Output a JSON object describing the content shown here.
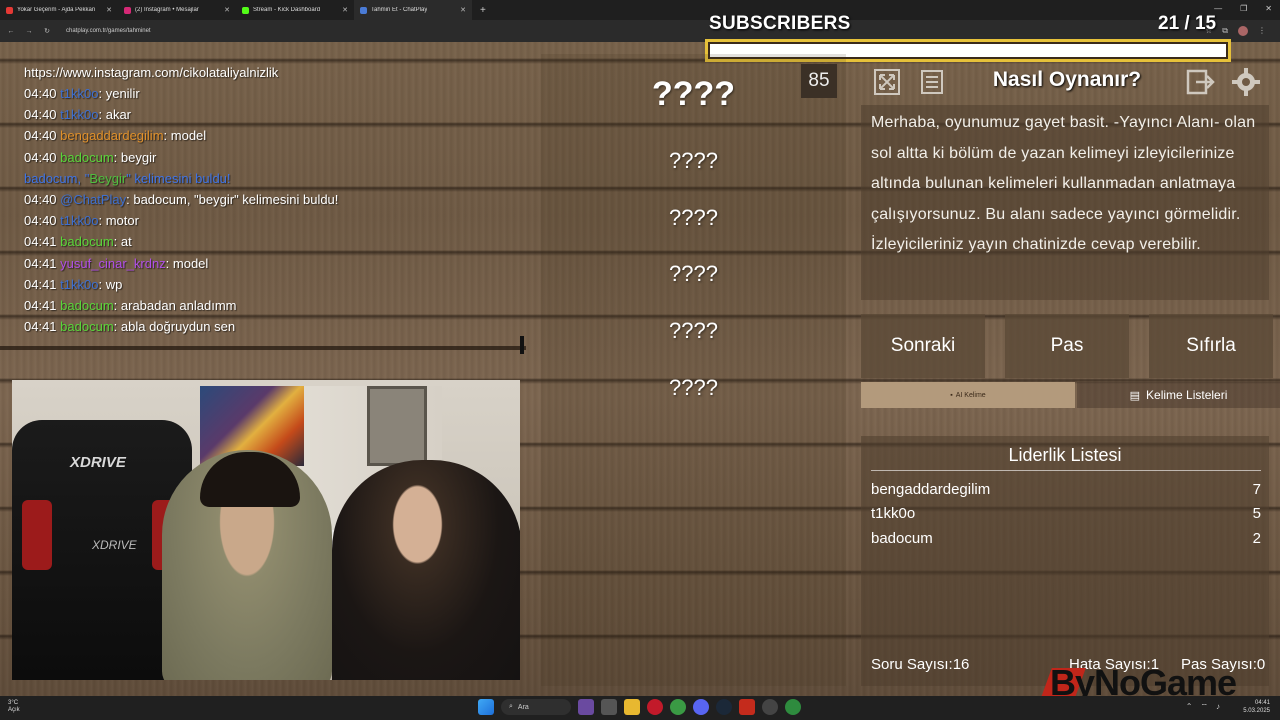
{
  "browser": {
    "tabs": [
      {
        "label": "Yokar Geçerim - Ajda Pekkan",
        "color": "#e53935"
      },
      {
        "label": "(2) Instagram • Mesajlar",
        "color": "#d62976"
      },
      {
        "label": "Stream - Kick Dashboard",
        "color": "#53fc18"
      },
      {
        "label": "Tahmin Et - ChatPlay",
        "color": "#4a7bd6"
      }
    ],
    "new_tab": "+",
    "url": "chatplay.com.tr/games/tahminet",
    "win_controls": [
      "—",
      "❐",
      "✕"
    ]
  },
  "subscribers": {
    "title": "SUBSCRIBERS",
    "count": "21 / 15",
    "progress": 1.0
  },
  "chat": {
    "url_line": "https://www.instagram.com/cikolataliyalnizlik",
    "messages": [
      {
        "time": "04:40",
        "user": "t1kk0o",
        "color": "#3d6fd0",
        "text": ": yenilir"
      },
      {
        "time": "04:40",
        "user": "t1kk0o",
        "color": "#3d6fd0",
        "text": ": akar"
      },
      {
        "time": "04:40",
        "user": "bengaddardegilim",
        "color": "#e0902a",
        "text": ": model"
      },
      {
        "time": "04:40",
        "user": "badocum",
        "color": "#5ad63a",
        "text": ": beygir"
      }
    ],
    "system": {
      "pre": "badocum, \"",
      "word": "Beygir",
      "post": "\" kelimesini buldu!"
    },
    "messages2": [
      {
        "time": "04:40",
        "user": "@ChatPlay",
        "color": "#3d6fd0",
        "text": ": badocum, \"beygir\" kelimesini buldu!"
      },
      {
        "time": "04:40",
        "user": "t1kk0o",
        "color": "#3d6fd0",
        "text": ": motor"
      },
      {
        "time": "04:41",
        "user": "badocum",
        "color": "#5ad63a",
        "text": ": at"
      },
      {
        "time": "04:41",
        "user": "yusuf_cinar_krdnz",
        "color": "#b04ee8",
        "text": ": model"
      },
      {
        "time": "04:41",
        "user": "t1kk0o",
        "color": "#3d6fd0",
        "text": ": wp"
      },
      {
        "time": "04:41",
        "user": "badocum",
        "color": "#5ad63a",
        "text": ": arabadan anladımm"
      },
      {
        "time": "04:41",
        "user": "badocum",
        "color": "#5ad63a",
        "text": ": abla doğruydun sen"
      }
    ]
  },
  "webcam": {
    "chair_brand": "XDRIVE"
  },
  "words": {
    "main": "????",
    "list": [
      "????",
      "????",
      "????",
      "????",
      "????"
    ],
    "timer": "85"
  },
  "howto": {
    "title": "Nasıl Oynanır?",
    "text": "Merhaba, oyunumuz gayet basit. -Yayıncı Alanı- olan sol altta ki bölüm de yazan kelimeyi izleyicilerinize altında bulunan kelimeleri kullanmadan anlatmaya çalışıyorsunuz. Bu alanı sadece yayıncı görmelidir. İzleyicileriniz yayın chatinizde cevap verebilir."
  },
  "controls": {
    "next": "Sonraki",
    "pass": "Pas",
    "reset": "Sıfırla"
  },
  "subtabs": {
    "ai": "AI Kelime",
    "lists": "Kelime Listeleri"
  },
  "leaderboard": {
    "title": "Liderlik Listesi",
    "rows": [
      {
        "name": "bengaddardegilim",
        "score": "7"
      },
      {
        "name": "t1kk0o",
        "score": "5"
      },
      {
        "name": "badocum",
        "score": "2"
      }
    ]
  },
  "stats": {
    "questions": "Soru Sayısı:16",
    "errors": "Hata Sayısı:1",
    "passes": "Pas Sayısı:0"
  },
  "brand": "ByNoGame",
  "taskbar": {
    "weather_temp": "3°C",
    "weather_desc": "Açık",
    "search": "Ara",
    "time": "04:41",
    "date": "5.03.2025"
  },
  "colors": {
    "subs_border": "#e6c13a",
    "sys_msg": "#3f74e6",
    "sys_word": "#4fbf3f"
  }
}
